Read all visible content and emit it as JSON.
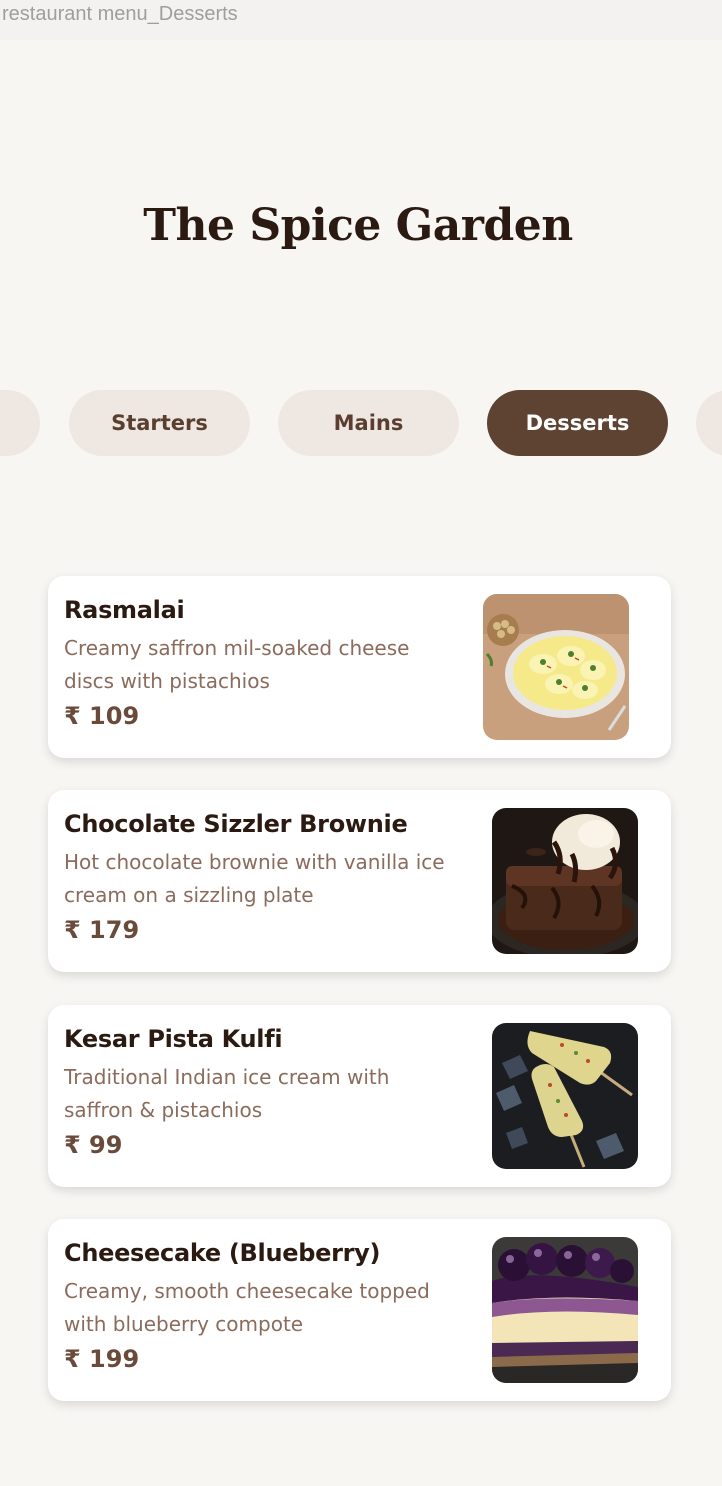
{
  "frame_label": "restaurant menu_Desserts",
  "restaurant_name": "The Spice Garden",
  "tabs": [
    {
      "label": "Starters",
      "active": false
    },
    {
      "label": "Mains",
      "active": false
    },
    {
      "label": "Desserts",
      "active": true
    }
  ],
  "menu_items": [
    {
      "name": "Rasmalai",
      "description": "Creamy saffron mil-soaked cheese discs with pistachios",
      "price": "₹ 109",
      "image_icon": "rasmalai-photo"
    },
    {
      "name": "Chocolate Sizzler Brownie",
      "description": "Hot chocolate brownie with vanilla ice cream on a sizzling plate",
      "price": "₹ 179",
      "image_icon": "brownie-photo"
    },
    {
      "name": "Kesar Pista Kulfi",
      "description": "Traditional Indian ice cream with saffron & pistachios",
      "price": "₹ 99",
      "image_icon": "kulfi-photo"
    },
    {
      "name": "Cheesecake (Blueberry)",
      "description": "Creamy, smooth cheesecake topped with blueberry compote",
      "price": "₹ 199",
      "image_icon": "cheesecake-photo"
    }
  ],
  "colors": {
    "background": "#f8f6f3",
    "tab_inactive": "#efe8e2",
    "tab_active": "#5e4232",
    "title_text": "#2b1a12",
    "desc_text": "#8a6b5c",
    "price_text": "#6a4a3a"
  }
}
